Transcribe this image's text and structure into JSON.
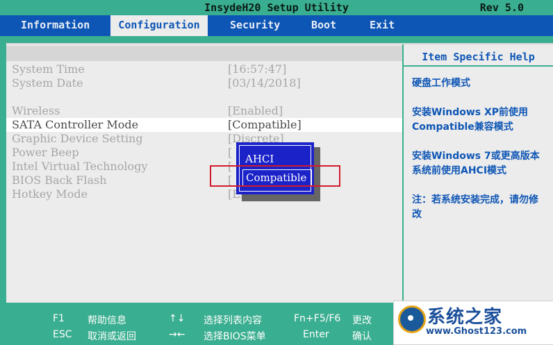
{
  "title": "InsydeH20 Setup Utility",
  "rev": "Rev 5.0",
  "tabs": [
    {
      "label": "Information"
    },
    {
      "label": "Configuration",
      "active": true
    },
    {
      "label": "Security"
    },
    {
      "label": "Boot"
    },
    {
      "label": "Exit"
    }
  ],
  "settings": [
    {
      "label": "System Time",
      "value": "[16:57:47]"
    },
    {
      "label": "System Date",
      "value": "[03/14/2018]"
    },
    {
      "label": "Wireless",
      "value": "[Enabled]"
    },
    {
      "label": "SATA Controller Mode",
      "value": "[Compatible]"
    },
    {
      "label": "Graphic Device Setting",
      "value": "[Discrete]"
    },
    {
      "label": "Power Beep",
      "value": "["
    },
    {
      "label": "Intel Virtual Technology",
      "value": "["
    },
    {
      "label": "BIOS Back Flash",
      "value": "["
    },
    {
      "label": "Hotkey Mode",
      "value": "[Enabled]"
    }
  ],
  "popup": {
    "options": [
      "AHCI",
      "Compatible"
    ],
    "selected": "Compatible"
  },
  "help": {
    "header": "Item Specific Help",
    "paragraphs": [
      "硬盘工作模式",
      "安装Windows XP前使用Compatible兼容模式",
      "安装Windows 7或更高版本系统前使用AHCI模式",
      "注：若系统安装完成，请勿修改"
    ]
  },
  "footer": {
    "keys": [
      {
        "key": "F1",
        "desc": "帮助信息"
      },
      {
        "key": "↑↓",
        "desc": "选择列表内容"
      },
      {
        "key": "Fn+F5/F6",
        "desc": "更改"
      },
      {
        "key": "ESC",
        "desc": "取消或返回"
      },
      {
        "key": "→←",
        "desc": "选择BIOS菜单"
      },
      {
        "key": "Enter",
        "desc": "确认"
      }
    ]
  },
  "watermark": {
    "name": "系统之家",
    "url": "www.Ghost123.com"
  },
  "colors": {
    "teal": "#3aae90",
    "blue": "#0e56b5",
    "popup_blue": "#1a22c8",
    "annotation_red": "#d21c2b"
  }
}
